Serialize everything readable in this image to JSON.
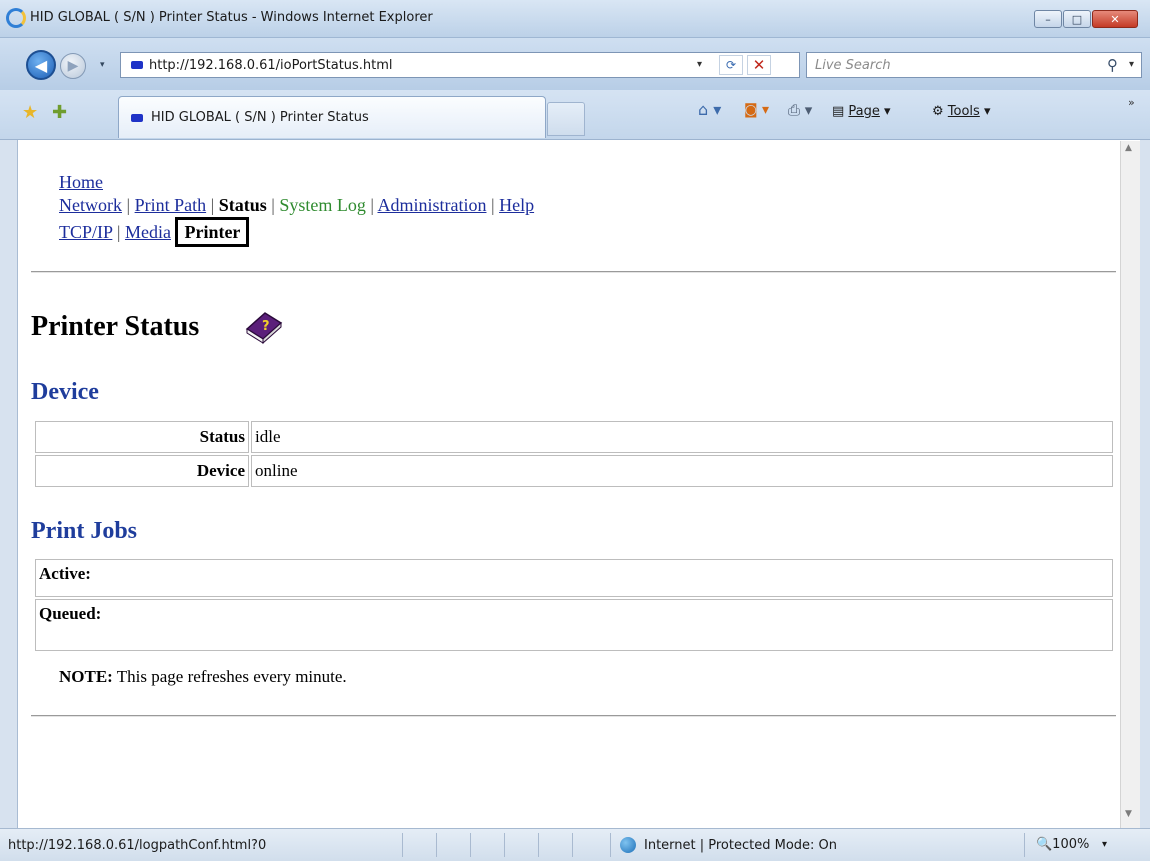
{
  "window": {
    "title": "HID GLOBAL ( S/N ) Printer Status - Windows Internet Explorer",
    "minimize_label": "–",
    "maximize_label": "□",
    "close_label": "✕"
  },
  "navbar": {
    "back_label": "◀",
    "forward_label": "▶",
    "dropdown": "▾",
    "address": "http://192.168.0.61/ioPortStatus.html",
    "refresh_label": "⟳",
    "stop_label": "✕",
    "search_placeholder": "Live Search",
    "search_icon_glyph": "⚲"
  },
  "tabbar": {
    "tab_label": "HID GLOBAL ( S/N ) Printer Status",
    "page_label": "Page",
    "tools_label": "Tools",
    "overflow": "»"
  },
  "content": {
    "nav": {
      "home": "Home",
      "row2": {
        "network": "Network",
        "print_path": "Print Path",
        "status": "Status",
        "system_log": "System Log",
        "administration": "Administration",
        "help": "Help"
      },
      "row3": {
        "tcpip": "TCP/IP",
        "media": "Media",
        "printer": "Printer"
      },
      "separator": "|"
    },
    "page_title": "Printer Status",
    "device_heading": "Device",
    "device_rows": [
      {
        "key": "Status",
        "value": "idle"
      },
      {
        "key": "Device",
        "value": "online"
      }
    ],
    "jobs_heading": "Print Jobs",
    "jobs_rows": [
      {
        "label": "Active:"
      },
      {
        "label": "Queued:"
      }
    ],
    "note_label": "NOTE:",
    "note_text": " This page refreshes every minute."
  },
  "statusbar": {
    "url": "http://192.168.0.61/logpathConf.html?0",
    "zone": "Internet | Protected Mode: On",
    "zoom": "🔍100%",
    "zoom_dropdown": "▾"
  },
  "colors": {
    "link": "#1c2d9c",
    "heading": "#1f3d9c",
    "visited_green": "#2f8b2f",
    "chrome_blue": "#c3d6eb"
  }
}
